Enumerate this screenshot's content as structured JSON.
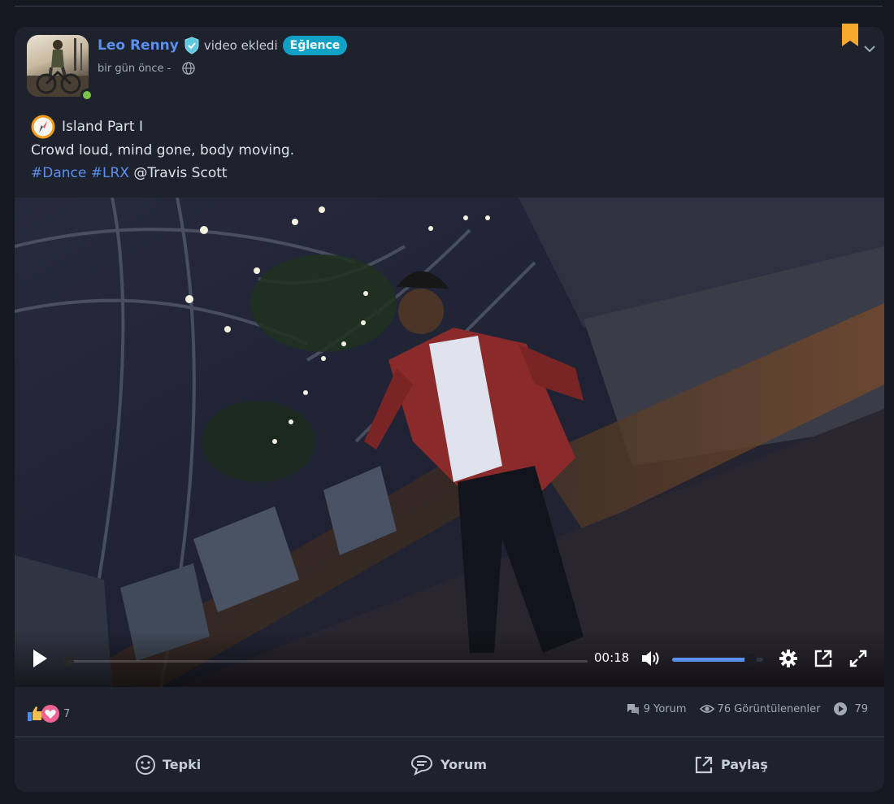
{
  "post": {
    "author": "Leo Renny",
    "action": "video ekledi",
    "category": "Eğlence",
    "time_ago": "bir gün önce -",
    "text": {
      "title": "Island Part I",
      "line2": "Crowd loud, mind gone, body moving.",
      "hashtag1": "#Dance",
      "hashtag2": "#LRX",
      "mention": "@Travis Scott"
    }
  },
  "video": {
    "time": "00:18",
    "progress": 0.0,
    "volume": 0.86
  },
  "stats": {
    "reaction_count": "7",
    "comments": "9 Yorum",
    "views": "76 Görüntülenenler",
    "plays": "79"
  },
  "actions": {
    "react": "Tepki",
    "comment": "Yorum",
    "share": "Paylaş"
  },
  "colors": {
    "accent": "#5b8ff0",
    "badge": "#11a1c7",
    "bookmark": "#f3a92d",
    "online": "#7bc24a",
    "card": "#1d222c",
    "page": "#141821"
  },
  "icons": [
    "verified-icon",
    "globe-icon",
    "bookmark-icon",
    "chevron-down-icon",
    "compass-icon",
    "play-icon",
    "volume-icon",
    "settings-icon",
    "popout-icon",
    "fullscreen-icon",
    "comments-icon",
    "eye-icon",
    "play-circle-icon",
    "smile-icon",
    "comment-icon",
    "share-icon"
  ]
}
